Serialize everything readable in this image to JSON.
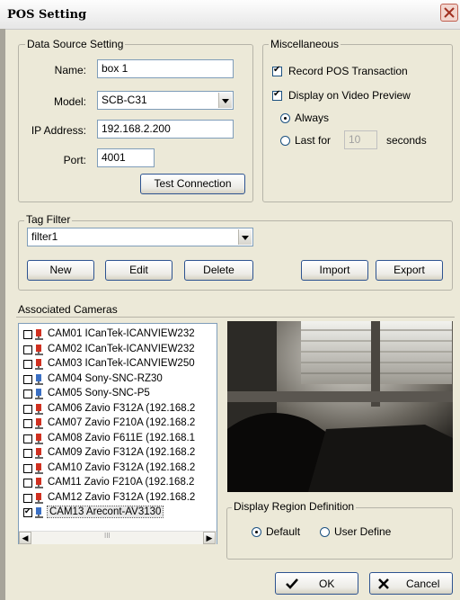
{
  "window": {
    "title": "POS Setting"
  },
  "data_source": {
    "legend": "Data Source Setting",
    "name_label": "Name:",
    "name_value": "box 1",
    "model_label": "Model:",
    "model_value": "SCB-C31",
    "ip_label": "IP Address:",
    "ip_value": "192.168.2.200",
    "port_label": "Port:",
    "port_value": "4001",
    "test_button": "Test Connection"
  },
  "misc": {
    "legend": "Miscellaneous",
    "record_label": "Record POS Transaction",
    "record_checked": true,
    "display_label": "Display on Video Preview",
    "display_checked": true,
    "always_label": "Always",
    "lastfor_label": "Last for",
    "lastfor_value": "10",
    "seconds_label": "seconds"
  },
  "tag_filter": {
    "legend": "Tag Filter",
    "selected": "filter1",
    "buttons": {
      "new": "New",
      "edit": "Edit",
      "delete": "Delete",
      "import": "Import",
      "export": "Export"
    }
  },
  "cameras": {
    "legend": "Associated Cameras",
    "items": [
      {
        "label": "CAM01 ICanTek-ICANVIEW232",
        "checked": false,
        "icon": "camera-red-icon"
      },
      {
        "label": "CAM02 ICanTek-ICANVIEW232",
        "checked": false,
        "icon": "camera-red-icon"
      },
      {
        "label": "CAM03 ICanTek-ICANVIEW250",
        "checked": false,
        "icon": "camera-red-icon"
      },
      {
        "label": "CAM04 Sony-SNC-RZ30",
        "checked": false,
        "icon": "camera-blue-icon"
      },
      {
        "label": "CAM05 Sony-SNC-P5",
        "checked": false,
        "icon": "camera-blue-icon"
      },
      {
        "label": "CAM06 Zavio F312A (192.168.2",
        "checked": false,
        "icon": "camera-red-icon"
      },
      {
        "label": "CAM07 Zavio F210A (192.168.2",
        "checked": false,
        "icon": "camera-red-icon"
      },
      {
        "label": "CAM08 Zavio F611E (192.168.1",
        "checked": false,
        "icon": "camera-red-icon"
      },
      {
        "label": "CAM09 Zavio F312A (192.168.2",
        "checked": false,
        "icon": "camera-red-icon"
      },
      {
        "label": "CAM10 Zavio F312A (192.168.2",
        "checked": false,
        "icon": "camera-red-icon"
      },
      {
        "label": "CAM11 Zavio F210A (192.168.2",
        "checked": false,
        "icon": "camera-red-icon"
      },
      {
        "label": "CAM12 Zavio F312A (192.168.2",
        "checked": false,
        "icon": "camera-red-icon"
      },
      {
        "label": "CAM13 Arecont-AV3130",
        "checked": true,
        "icon": "camera-blue-icon"
      }
    ],
    "scroll_mark": "III"
  },
  "region": {
    "legend": "Display Region Definition",
    "default_label": "Default",
    "user_label": "User Define"
  },
  "footer": {
    "ok": "OK",
    "cancel": "Cancel"
  },
  "colors": {
    "red_camera": "#d03020",
    "blue_camera": "#3a6fc4",
    "ok_check": "#000000"
  }
}
